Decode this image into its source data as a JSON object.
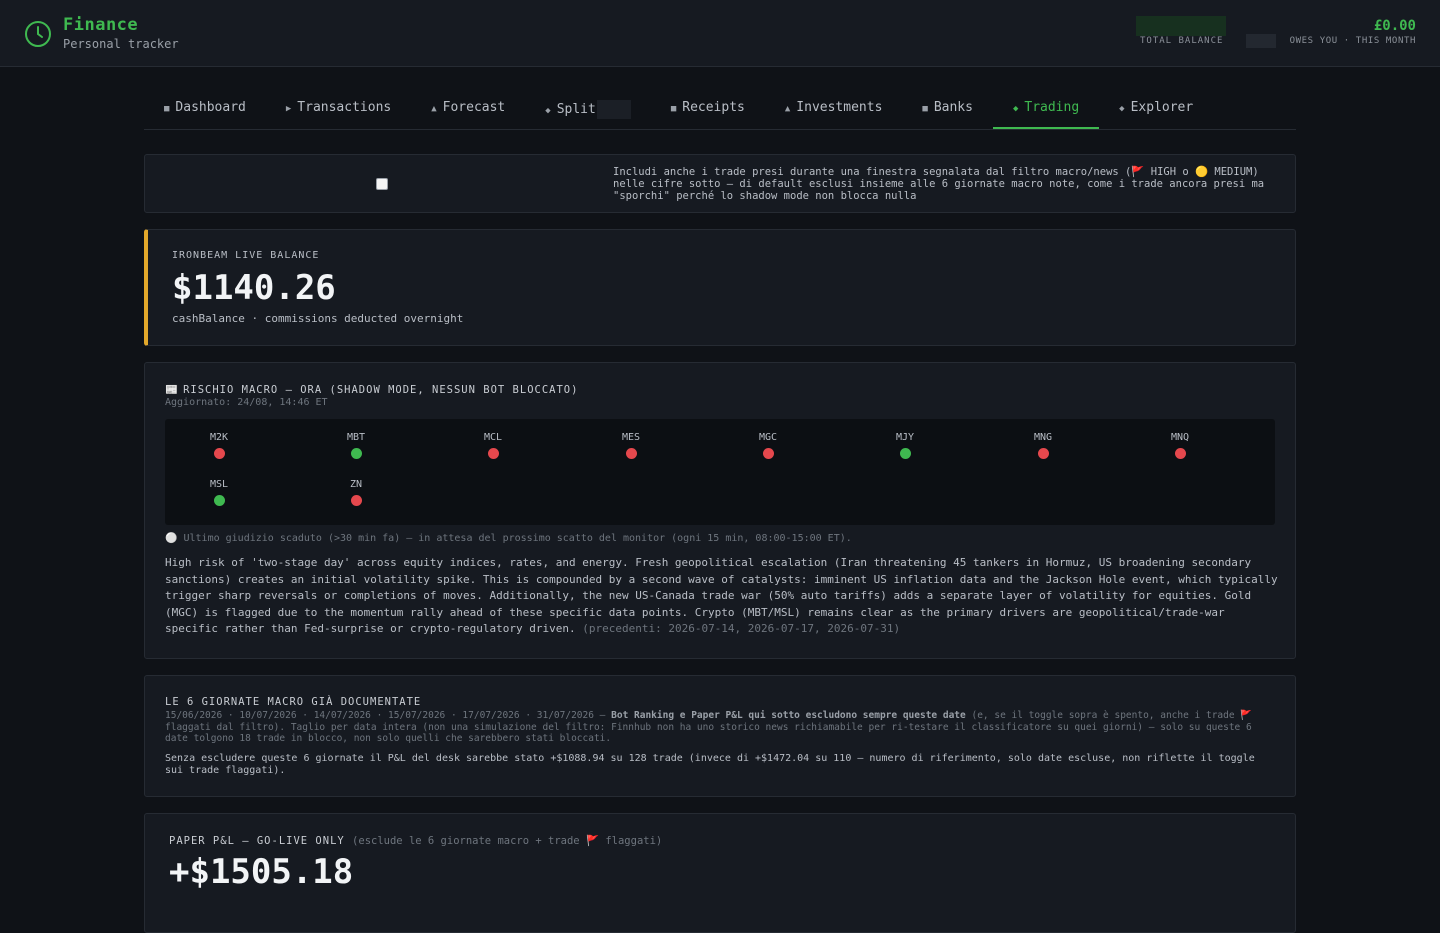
{
  "app": {
    "title": "Finance",
    "subtitle": "Personal tracker",
    "icon": "clock-icon",
    "accent": "#3fb950"
  },
  "topbar": {
    "total_balance_label": "TOTAL BALANCE",
    "month_amount": "£0.00",
    "month_label": "OWES YOU · THIS MONTH"
  },
  "nav": {
    "items": [
      {
        "glyph": "■",
        "label": "Dashboard"
      },
      {
        "glyph": "▶",
        "label": "Transactions"
      },
      {
        "glyph": "▲",
        "label": "Forecast"
      },
      {
        "glyph": "◆",
        "label": "Split"
      },
      {
        "glyph": "■",
        "label": "Receipts"
      },
      {
        "glyph": "▲",
        "label": "Investments"
      },
      {
        "glyph": "■",
        "label": "Banks"
      },
      {
        "glyph": "◆",
        "label": "Trading"
      },
      {
        "glyph": "◆",
        "label": "Explorer"
      }
    ],
    "active": "Trading"
  },
  "toggle": {
    "checked": false,
    "text": "Includi anche i trade presi durante una finestra segnalata dal filtro macro/news (🚩 HIGH o 🟡 MEDIUM) nelle cifre sotto — di default esclusi insieme alle 6 giornate macro note, come i trade ancora presi ma \"sporchi\" perché lo shadow mode non blocca nulla"
  },
  "balance": {
    "label": "IRONBEAM LIVE BALANCE",
    "value": "$1140.26",
    "note": "cashBalance · commissions deducted overnight",
    "accent": "#e3a82b"
  },
  "macro": {
    "icon": "📰",
    "title": "RISCHIO MACRO — ORA (SHADOW MODE, NESSUN BOT BLOCCATO)",
    "updated": "Aggiornato: 24/08, 14:46 ET",
    "instruments": [
      {
        "name": "M2K",
        "status": "red"
      },
      {
        "name": "MBT",
        "status": "green"
      },
      {
        "name": "MCL",
        "status": "red"
      },
      {
        "name": "MES",
        "status": "red"
      },
      {
        "name": "MGC",
        "status": "red"
      },
      {
        "name": "MJY",
        "status": "green"
      },
      {
        "name": "MNG",
        "status": "red"
      },
      {
        "name": "MNQ",
        "status": "red"
      },
      {
        "name": "MSL",
        "status": "green"
      },
      {
        "name": "ZN",
        "status": "red"
      }
    ],
    "expired_glyph": "⚪",
    "expired_text": "Ultimo giudizio scaduto (>30 min fa) — in attesa del prossimo scatto del monitor (ogni 15 min, 08:00-15:00 ET).",
    "body": "High risk of 'two-stage day' across equity indices, rates, and energy. Fresh geopolitical escalation (Iran threatening 45 tankers in Hormuz, US broadening secondary sanctions) creates an initial volatility spike. This is compounded by a second wave of catalysts: imminent US inflation data and the Jackson Hole event, which typically trigger sharp reversals or completions of moves. Additionally, the new US-Canada trade war (50% auto tariffs) adds a separate layer of volatility for equities. Gold (MGC) is flagged due to the momentum rally ahead of these specific data points. Crypto (MBT/MSL) remains clear as the primary drivers are geopolitical/trade-war specific rather than Fed-surprise or crypto-regulatory driven.",
    "previous": "(precedenti: 2026-07-14, 2026-07-17, 2026-07-31)",
    "colors": {
      "red": "#e5484d",
      "green": "#3fb950"
    }
  },
  "docs": {
    "title": "LE 6 GIORNATE MACRO GIÀ DOCUMENTATE",
    "dates": "15/06/2026 · 10/07/2026 · 14/07/2026 · 15/07/2026 · 17/07/2026 · 31/07/2026 —",
    "bold": "Bot Ranking e Paper P&L qui sotto escludono sempre queste date",
    "rest": "(e, se il toggle sopra è spento, anche i trade 🚩 flaggati dal filtro). Taglio per data intera (non una simulazione del filtro: Finnhub non ha uno storico news richiamabile per ri-testare il classificatore su quei giorni) — solo su queste 6 date tolgono 18 trade in blocco, non solo quelli che sarebbero stati bloccati.",
    "note": "Senza escludere queste 6 giornate il P&L del desk sarebbe stato +$1088.94 su 128 trade (invece di +$1472.04 su 110 — numero di riferimento, solo date escluse, non riflette il toggle sui trade flaggati)."
  },
  "pnl": {
    "title": "PAPER P&L — GO-LIVE ONLY",
    "subtitle": "(esclude le 6 giornate macro + trade 🚩 flaggati)",
    "value": "+$1505.18"
  }
}
